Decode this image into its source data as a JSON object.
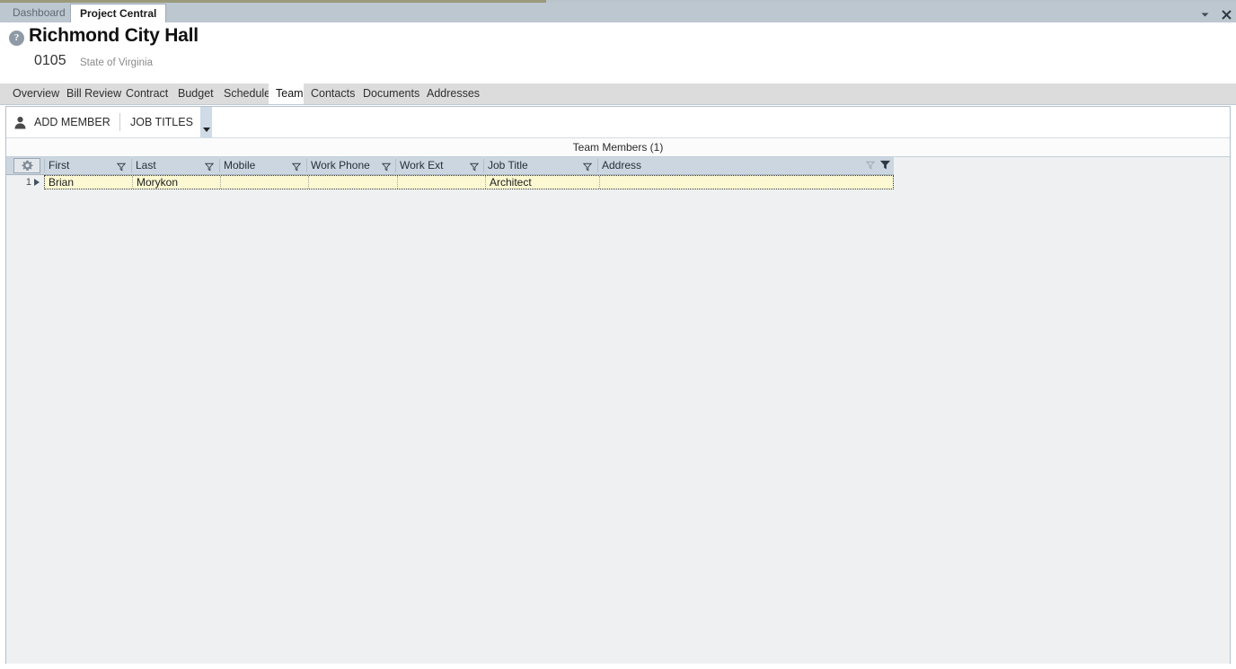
{
  "window": {
    "tabs": [
      {
        "label": "Dashboard",
        "active": false
      },
      {
        "label": "Project Central",
        "active": true
      }
    ],
    "controls": {
      "dropdown_icon": "chevron-down-icon",
      "close_icon": "close-icon"
    }
  },
  "header": {
    "help_icon": "help-circle-icon",
    "help_glyph": "?",
    "title": "Richmond City Hall",
    "project_number": "0105",
    "subtitle": "State of Virginia"
  },
  "section_tabs": [
    {
      "label": "Overview",
      "active": false
    },
    {
      "label": "Bill Review",
      "active": false
    },
    {
      "label": "Contract",
      "active": false
    },
    {
      "label": "Budget",
      "active": false
    },
    {
      "label": "Schedule",
      "active": false
    },
    {
      "label": "Team",
      "active": true
    },
    {
      "label": "Contacts",
      "active": false
    },
    {
      "label": "Documents",
      "active": false
    },
    {
      "label": "Addresses",
      "active": false
    }
  ],
  "toolbar": {
    "add_member_label": "ADD MEMBER",
    "add_member_icon": "person-icon",
    "job_titles_label": "JOB TITLES",
    "overflow_icon": "caret-down-icon"
  },
  "grid": {
    "caption": "Team Members (1)",
    "settings_icon": "gear-icon",
    "filter_icon": "funnel-icon",
    "columns": [
      {
        "label": "First"
      },
      {
        "label": "Last"
      },
      {
        "label": "Mobile"
      },
      {
        "label": "Work Phone"
      },
      {
        "label": "Work Ext"
      },
      {
        "label": "Job Title"
      },
      {
        "label": "Address"
      }
    ],
    "rows": [
      {
        "number": "1",
        "expand_icon": "caret-right-icon",
        "First": "Brian",
        "Last": "Morykon",
        "Mobile": "",
        "Work Phone": "",
        "Work Ext": "",
        "Job Title": "Architect",
        "Address": ""
      }
    ]
  },
  "colors": {
    "tabbar_bg": "#bcc7d0",
    "grid_header_bg": "#ccd6e0",
    "row_selected_bg": "#fbf8d2",
    "panel_bg": "#eef0f2",
    "accent_strip": "#9a9a7a"
  }
}
